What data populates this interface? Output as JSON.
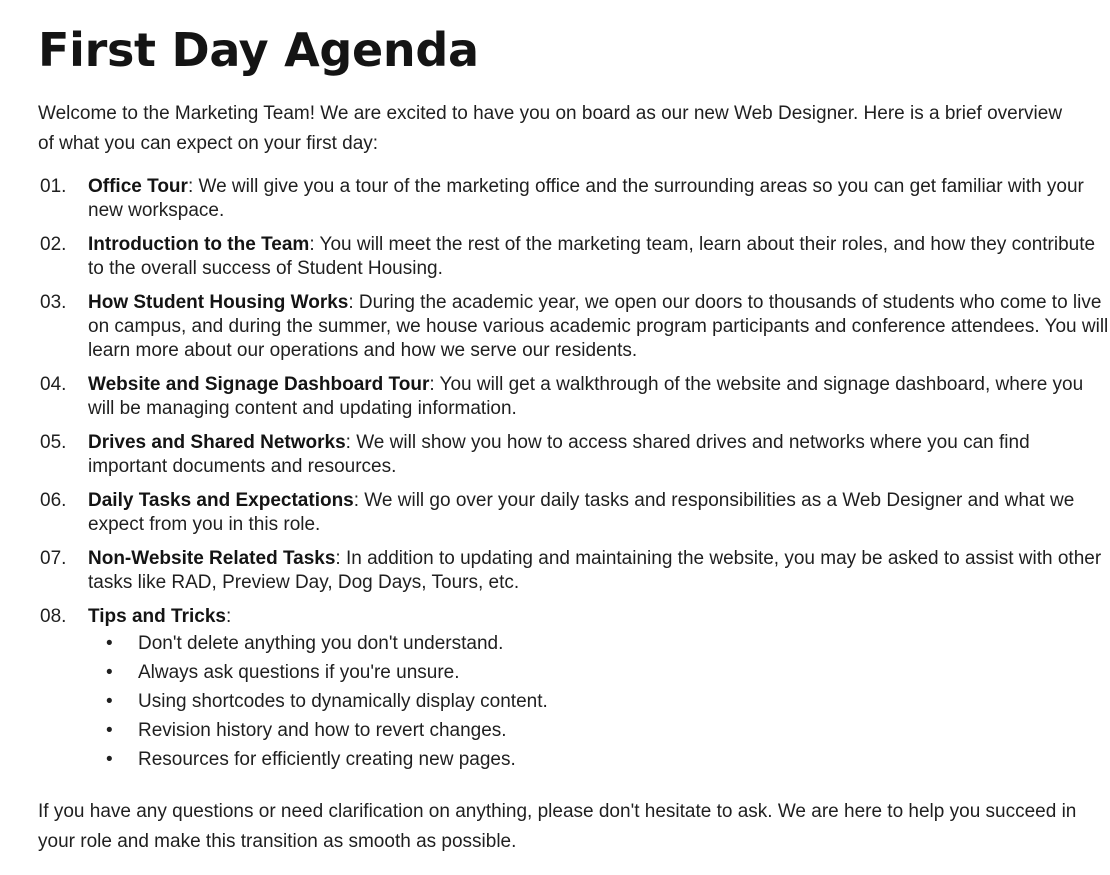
{
  "title": "First Day Agenda",
  "intro": "Welcome to the Marketing Team! We are excited to have you on board as our new Web Designer. Here is a brief overview of what you can expect on your first day:",
  "agenda": [
    {
      "num": "01.",
      "heading": "Office Tour",
      "sep": ":",
      "text": " We will give you a tour of the marketing office and the surrounding areas so you can get familiar with your new workspace."
    },
    {
      "num": "02.",
      "heading": "Introduction to the Team",
      "sep": ":",
      "text": " You will meet the rest of the marketing team, learn about their roles, and how they contribute to the overall success of Student Housing."
    },
    {
      "num": "03.",
      "heading": "How Student Housing Works",
      "sep": ":",
      "text": " During the academic year, we open our doors to thousands of students who come to live on campus, and during the summer, we house various academic program participants and conference attendees. You will learn more about our operations and how we serve our residents."
    },
    {
      "num": "04.",
      "heading": "Website and Signage Dashboard Tour",
      "sep": ":",
      "text": " You will get a walkthrough of the website and signage dashboard, where you will be managing content and updating information."
    },
    {
      "num": "05.",
      "heading": "Drives and Shared Networks",
      "sep": ":",
      "text": " We will show you how to access shared drives and networks where you can find important documents and resources."
    },
    {
      "num": "06.",
      "heading": "Daily Tasks and Expectations",
      "sep": ":",
      "text": " We will go over your daily tasks and responsibilities as a Web Designer and what we expect from you in this role."
    },
    {
      "num": "07.",
      "heading": "Non-Website Related Tasks",
      "sep": ":",
      "text": " In addition to updating and maintaining the website, you may be asked to assist with other tasks like RAD, Preview Day, Dog Days, Tours, etc."
    },
    {
      "num": "08.",
      "heading": "Tips and Tricks",
      "sep": ":",
      "text": ""
    }
  ],
  "tips_bullet": "•",
  "tips": [
    "Don't delete anything you don't understand.",
    "Always ask questions if you're unsure.",
    "Using shortcodes to dynamically display content.",
    "Revision history and how to revert changes.",
    "Resources for efficiently creating new pages."
  ],
  "outro": "If you have any questions or need clarification on anything, please don't hesitate to ask. We are here to help you succeed in your role and make this transition as smooth as possible."
}
